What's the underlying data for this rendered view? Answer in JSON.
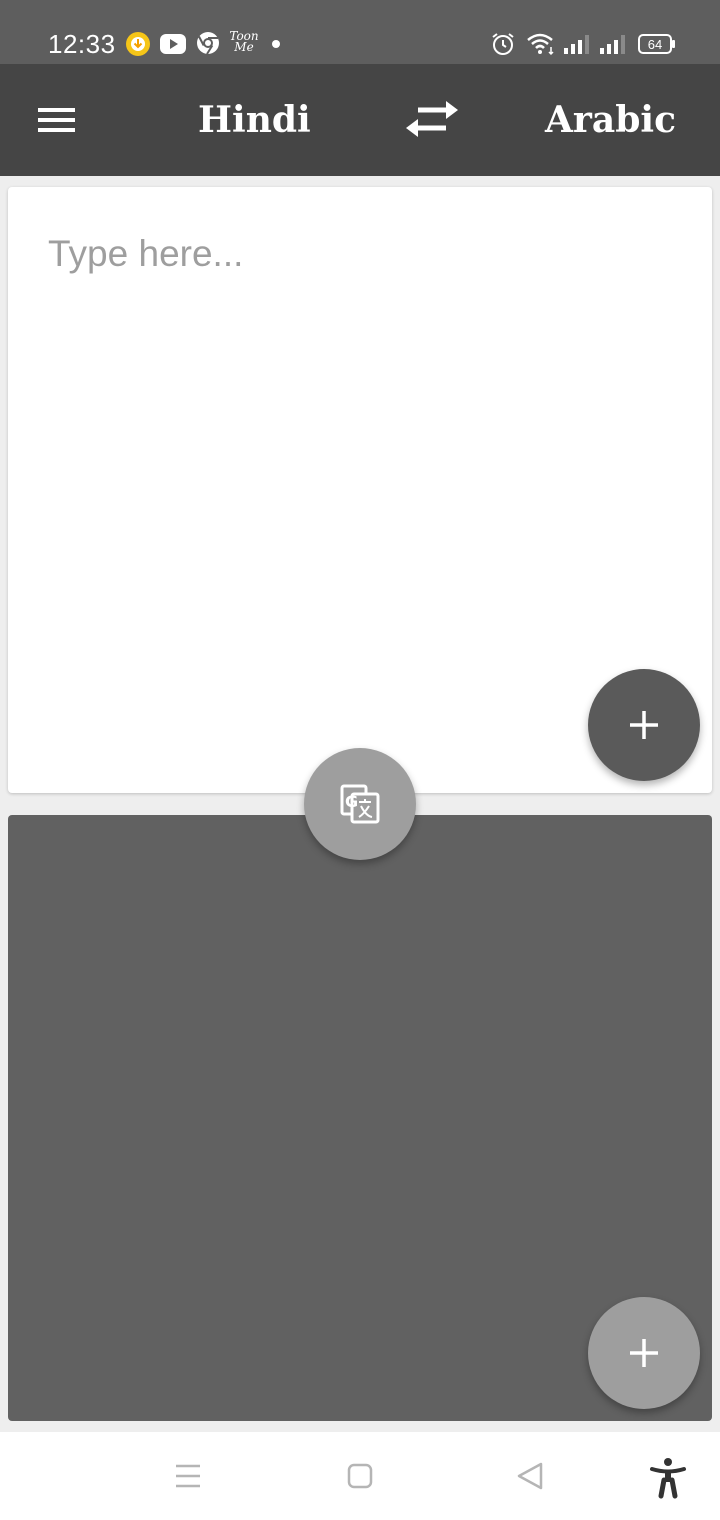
{
  "status_bar": {
    "time": "12:33",
    "battery_level": "64",
    "toonme_label": "Toon Me",
    "icons": [
      "download-icon",
      "youtube-icon",
      "chrome-icon",
      "toonme-icon",
      "notification-dot-icon",
      "alarm-icon",
      "wifi-icon",
      "signal-icon",
      "signal-icon",
      "battery-icon"
    ]
  },
  "app_bar": {
    "menu_icon": "hamburger-menu-icon",
    "source_language": "Hindi",
    "swap_icon": "swap-arrows-icon",
    "target_language": "Arabic"
  },
  "input_card": {
    "placeholder": "Type here...",
    "value": "",
    "fab_icon": "plus-icon"
  },
  "translate_button": {
    "icon": "google-translate-icon"
  },
  "output_card": {
    "text": "",
    "fab_icon": "plus-icon"
  },
  "nav_bar": {
    "icons": [
      "recent-apps-icon",
      "home-icon",
      "back-icon",
      "accessibility-icon"
    ]
  },
  "colors": {
    "status_bar": "#5e5e5e",
    "app_bar": "#454545",
    "background": "#eeeeee",
    "output_card": "#616161",
    "fab_dark": "#5a5a5a",
    "fab_light": "#9e9e9e"
  }
}
